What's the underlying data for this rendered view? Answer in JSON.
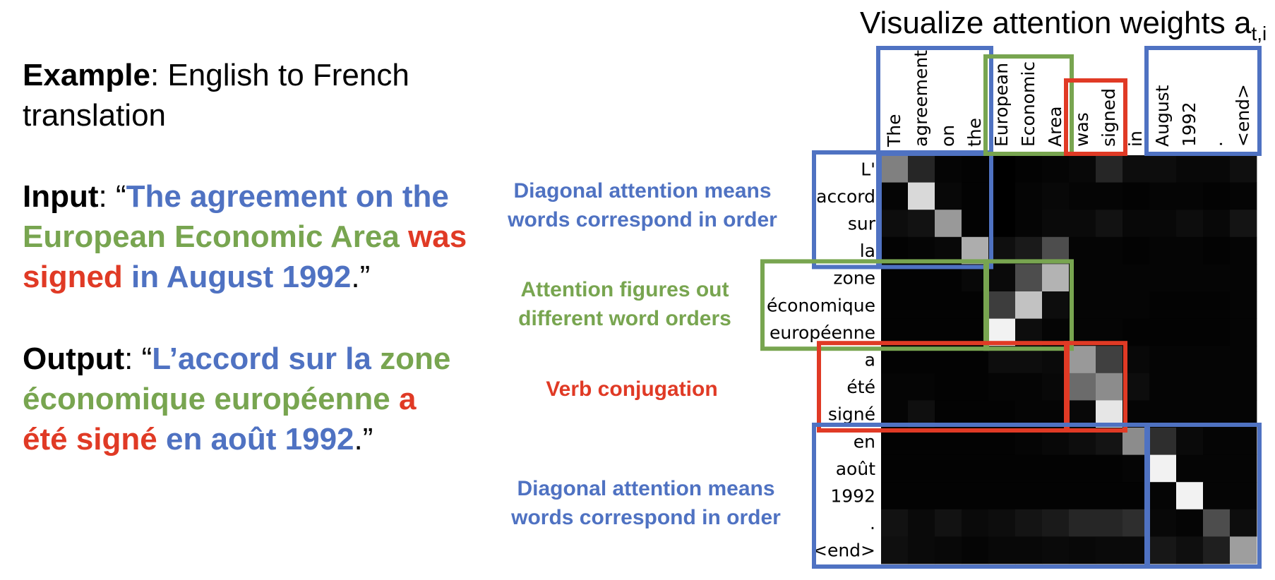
{
  "example": {
    "label": "Example",
    "line1": ": English to French",
    "line2": "translation"
  },
  "input": {
    "label": "Input",
    "lines": [
      [
        {
          "text": ": “",
          "color": "black"
        },
        {
          "text": "The agreement on the",
          "color": "blue"
        }
      ],
      [
        {
          "text": "European Economic Area",
          "color": "green"
        },
        {
          "text": " was",
          "color": "red"
        }
      ],
      [
        {
          "text": "signed",
          "color": "red"
        },
        {
          "text": " in August 1992",
          "color": "blue"
        },
        {
          "text": ".”",
          "color": "black"
        }
      ]
    ]
  },
  "output": {
    "label": "Output",
    "lines": [
      [
        {
          "text": ": “",
          "color": "black"
        },
        {
          "text": "L’accord sur la ",
          "color": "blue"
        },
        {
          "text": "zone",
          "color": "green"
        }
      ],
      [
        {
          "text": "économique européenne",
          "color": "green"
        },
        {
          "text": " a",
          "color": "red"
        }
      ],
      [
        {
          "text": "été signé",
          "color": "red"
        },
        {
          "text": " en août 1992",
          "color": "blue"
        },
        {
          "text": ".”",
          "color": "black"
        }
      ]
    ]
  },
  "title": {
    "main": "Visualize attention weights a",
    "sub": "t,i"
  },
  "notes": {
    "diag_top": [
      "Diagonal attention means",
      "words correspond in order"
    ],
    "order": [
      "Attention figures out",
      "different word orders"
    ],
    "verb": [
      "Verb conjugation"
    ],
    "diag_bottom": [
      "Diagonal attention means",
      "words correspond in order"
    ]
  },
  "colors": {
    "blue": "#4f72c2",
    "green": "#78a550",
    "red": "#e03a25",
    "black": "#000000"
  },
  "chart_data": {
    "type": "heatmap",
    "title": "Visualize attention weights a t,i",
    "x_tokens": [
      "The",
      "agreement",
      "on",
      "the",
      "European",
      "Economic",
      "Area",
      "was",
      "signed",
      "in",
      "August",
      "1992",
      ".",
      "<end>"
    ],
    "y_tokens": [
      "L'",
      "accord",
      "sur",
      "la",
      "zone",
      "économique",
      "européenne",
      "a",
      "été",
      "signé",
      "en",
      "août",
      "1992",
      ".",
      "<end>"
    ],
    "values": [
      [
        0.5,
        0.15,
        0.02,
        0.01,
        0.0,
        0.01,
        0.02,
        0.03,
        0.15,
        0.05,
        0.05,
        0.03,
        0.03,
        0.06
      ],
      [
        0.02,
        0.85,
        0.03,
        0.01,
        0.0,
        0.02,
        0.03,
        0.02,
        0.02,
        0.01,
        0.02,
        0.02,
        0.01,
        0.02
      ],
      [
        0.05,
        0.07,
        0.6,
        0.01,
        0.0,
        0.02,
        0.04,
        0.04,
        0.07,
        0.03,
        0.03,
        0.05,
        0.03,
        0.08
      ],
      [
        0.01,
        0.02,
        0.03,
        0.68,
        0.06,
        0.1,
        0.3,
        0.02,
        0.02,
        0.01,
        0.02,
        0.02,
        0.01,
        0.02
      ],
      [
        0.01,
        0.01,
        0.01,
        0.03,
        0.04,
        0.3,
        0.7,
        0.02,
        0.02,
        0.02,
        0.02,
        0.02,
        0.02,
        0.02
      ],
      [
        0.01,
        0.01,
        0.01,
        0.01,
        0.24,
        0.76,
        0.05,
        0.02,
        0.02,
        0.02,
        0.01,
        0.01,
        0.01,
        0.02
      ],
      [
        0.01,
        0.01,
        0.01,
        0.01,
        0.95,
        0.05,
        0.02,
        0.02,
        0.02,
        0.01,
        0.01,
        0.01,
        0.01,
        0.02
      ],
      [
        0.01,
        0.01,
        0.01,
        0.01,
        0.05,
        0.05,
        0.04,
        0.6,
        0.25,
        0.03,
        0.02,
        0.02,
        0.02,
        0.02
      ],
      [
        0.02,
        0.02,
        0.01,
        0.01,
        0.02,
        0.02,
        0.03,
        0.42,
        0.55,
        0.05,
        0.02,
        0.02,
        0.02,
        0.02
      ],
      [
        0.02,
        0.06,
        0.01,
        0.01,
        0.01,
        0.02,
        0.02,
        0.03,
        0.9,
        0.02,
        0.02,
        0.02,
        0.02,
        0.02
      ],
      [
        0.01,
        0.01,
        0.01,
        0.01,
        0.01,
        0.02,
        0.03,
        0.05,
        0.08,
        0.55,
        0.18,
        0.04,
        0.02,
        0.02
      ],
      [
        0.01,
        0.01,
        0.01,
        0.01,
        0.01,
        0.01,
        0.01,
        0.01,
        0.01,
        0.02,
        0.95,
        0.02,
        0.02,
        0.02
      ],
      [
        0.01,
        0.01,
        0.01,
        0.01,
        0.01,
        0.01,
        0.01,
        0.01,
        0.01,
        0.01,
        0.02,
        0.95,
        0.02,
        0.02
      ],
      [
        0.07,
        0.04,
        0.07,
        0.04,
        0.05,
        0.08,
        0.1,
        0.15,
        0.15,
        0.18,
        0.03,
        0.02,
        0.3,
        0.05
      ],
      [
        0.06,
        0.04,
        0.03,
        0.02,
        0.03,
        0.03,
        0.04,
        0.03,
        0.04,
        0.04,
        0.09,
        0.06,
        0.12,
        0.62
      ]
    ],
    "value_range": [
      0,
      1
    ],
    "colormap": "gray",
    "highlight_boxes": [
      {
        "color": "blue",
        "x_from": "The",
        "x_to": "the",
        "y_from": "L'",
        "y_to": "la"
      },
      {
        "color": "green",
        "x_from": "European",
        "x_to": "Area",
        "y_from": "zone",
        "y_to": "européenne"
      },
      {
        "color": "red",
        "x_from": "was",
        "x_to": "signed",
        "y_from": "a",
        "y_to": "signé"
      },
      {
        "color": "blue",
        "x_from": "August",
        "x_to": "<end>",
        "y_from": "en",
        "y_to": "<end>"
      }
    ]
  }
}
